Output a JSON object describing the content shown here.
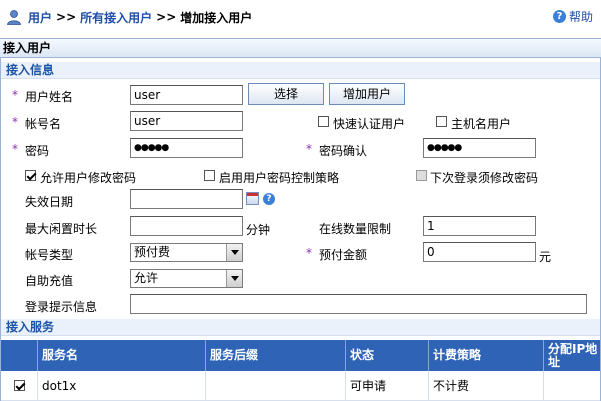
{
  "breadcrumb": {
    "items": [
      "用户",
      "所有接入用户",
      "增加接入用户"
    ],
    "separator": ">>"
  },
  "help_label": "帮助",
  "panel_title": "接入用户",
  "section_info": "接入信息",
  "form": {
    "username_label": "用户姓名",
    "username_value": "user",
    "select_button": "选择",
    "add_user_button": "增加用户",
    "account_label": "帐号名",
    "account_value": "user",
    "fast_auth_label": "快速认证用户",
    "host_name_label": "主机名用户",
    "password_label": "密码",
    "password_value": "●●●●●",
    "password_confirm_label": "密码确认",
    "password_confirm_value": "●●●●●",
    "allow_change_pwd_label": "允许用户修改密码",
    "enable_pwd_policy_label": "启用用户密码控制策略",
    "must_change_next_label": "下次登录须修改密码",
    "expire_date_label": "失效日期",
    "expire_date_value": "",
    "max_idle_label": "最大闲置时长",
    "max_idle_value": "",
    "minutes_unit": "分钟",
    "online_limit_label": "在线数量限制",
    "online_limit_value": "1",
    "account_type_label": "帐号类型",
    "account_type_value": "预付费",
    "prepaid_amount_label": "预付金额",
    "prepaid_amount_value": "0",
    "yuan_unit": "元",
    "self_recharge_label": "自助充值",
    "self_recharge_value": "允许",
    "login_tip_label": "登录提示信息",
    "login_tip_value": ""
  },
  "section_service": "接入服务",
  "service_table": {
    "columns": [
      "服务名",
      "服务后缀",
      "状态",
      "计费策略",
      "分配IP地址"
    ],
    "rows": [
      {
        "checked": true,
        "name": "dot1x",
        "suffix": "",
        "status": "可申请",
        "billing": "不计费",
        "ip": ""
      }
    ]
  },
  "colors": {
    "link_blue": "#1f4fa8",
    "required_star": "#8f2fb3",
    "table_header": "#2e63b5"
  }
}
